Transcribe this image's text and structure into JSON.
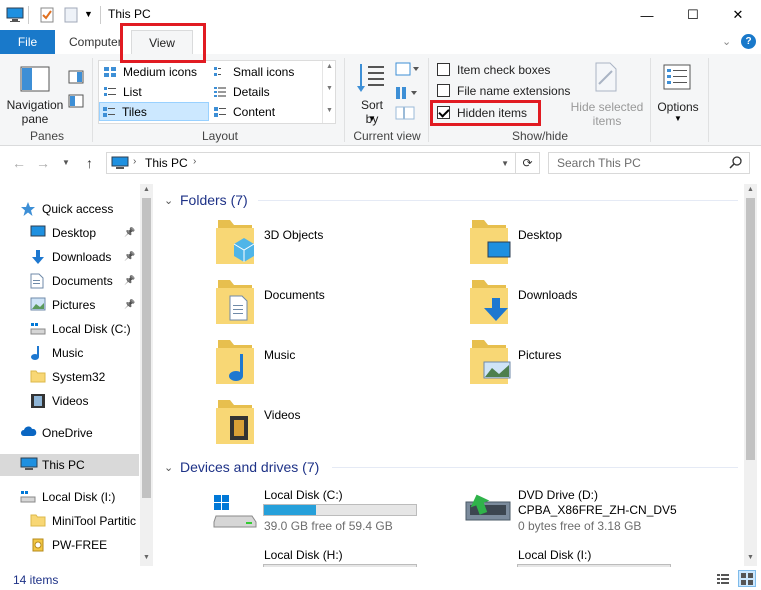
{
  "window": {
    "title": "This PC",
    "minimize": "—",
    "maximize": "☐",
    "close": "✕"
  },
  "ribbon_tabs": {
    "file": "File",
    "computer": "Computer",
    "view": "View",
    "collapse": "⌄",
    "help": "?"
  },
  "ribbon": {
    "panes": {
      "group_label": "Panes",
      "navigation_pane": "Navigation pane"
    },
    "layout": {
      "group_label": "Layout",
      "items": [
        "Medium icons",
        "Small icons",
        "List",
        "Details",
        "Tiles",
        "Content"
      ],
      "selected": "Tiles"
    },
    "current_view": {
      "group_label": "Current view",
      "sort_by": "Sort by"
    },
    "show_hide": {
      "group_label": "Show/hide",
      "item_check_boxes": "Item check boxes",
      "item_check_boxes_checked": false,
      "file_name_extensions": "File name extensions",
      "file_name_extensions_checked": false,
      "hidden_items": "Hidden items",
      "hidden_items_checked": true,
      "hide_selected_items": "Hide selected items"
    },
    "options": {
      "label": "Options"
    }
  },
  "address_bar": {
    "location": "This PC",
    "search_placeholder": "Search This PC"
  },
  "nav_pane": {
    "items": [
      {
        "label": "Quick access",
        "icon": "star-icon"
      },
      {
        "label": "Desktop",
        "icon": "desktop-icon",
        "pinned": true
      },
      {
        "label": "Downloads",
        "icon": "downloads-icon",
        "pinned": true
      },
      {
        "label": "Documents",
        "icon": "documents-icon",
        "pinned": true
      },
      {
        "label": "Pictures",
        "icon": "pictures-icon",
        "pinned": true
      },
      {
        "label": "Local Disk (C:)",
        "icon": "drive-icon"
      },
      {
        "label": "Music",
        "icon": "music-icon"
      },
      {
        "label": "System32",
        "icon": "folder-icon"
      },
      {
        "label": "Videos",
        "icon": "videos-icon"
      },
      {
        "label": "OneDrive",
        "icon": "cloud-icon"
      },
      {
        "label": "This PC",
        "icon": "computer-icon",
        "selected": true
      },
      {
        "label": "Local Disk (I:)",
        "icon": "drive-icon"
      },
      {
        "label": "MiniTool Partitic",
        "icon": "folder-icon"
      },
      {
        "label": "PW-FREE",
        "icon": "disc-icon"
      }
    ]
  },
  "content": {
    "folders_header": "Folders (7)",
    "folders": [
      "3D Objects",
      "Desktop",
      "Documents",
      "Downloads",
      "Music",
      "Pictures",
      "Videos"
    ],
    "drives_header": "Devices and drives (7)",
    "drives": [
      {
        "name": "Local Disk (C:)",
        "free": "39.0 GB free of 59.4 GB",
        "used_fraction": 0.34
      },
      {
        "name": "DVD Drive (D:)",
        "label": "CPBA_X86FRE_ZH-CN_DV5",
        "free": "0 bytes free of 3.18 GB"
      },
      {
        "name": "Local Disk (H:)"
      },
      {
        "name": "Local Disk (I:)"
      }
    ]
  },
  "status": {
    "count": "14 items"
  },
  "colors": {
    "accent": "#1979ca",
    "highlight_red": "#e11b22",
    "folder_yellow": "#f8d775",
    "drive_fill": "#26a0da"
  }
}
